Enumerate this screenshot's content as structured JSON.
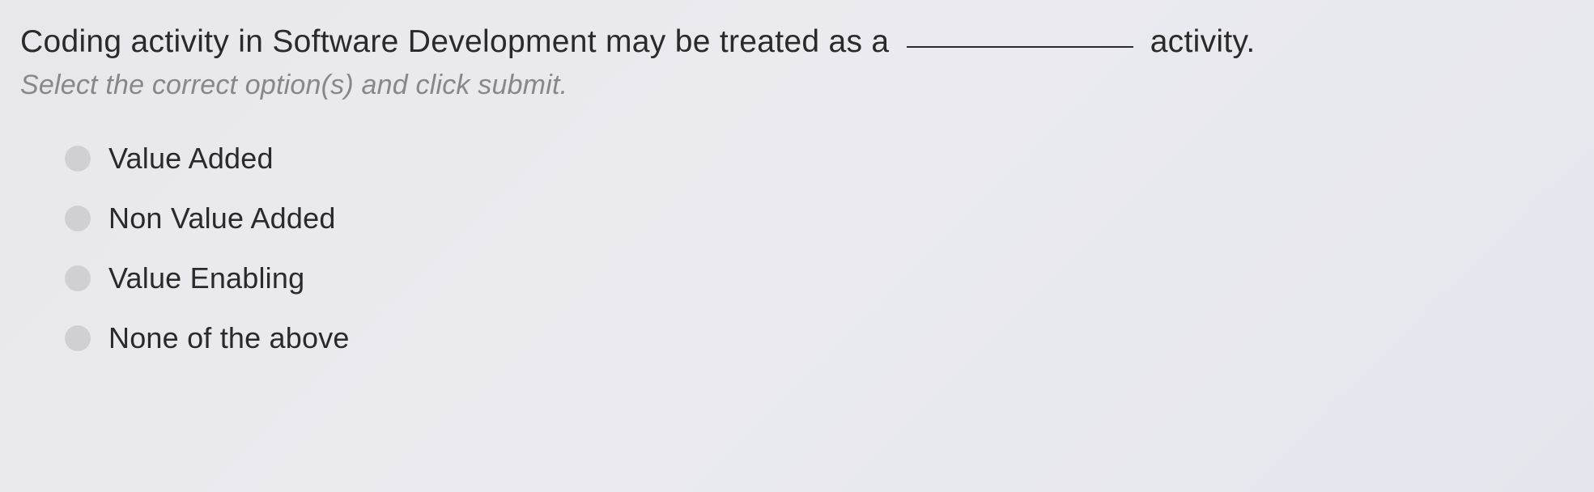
{
  "question": {
    "text_before_blank": "Coding activity in Software Development may be treated as a",
    "text_after_blank": "activity."
  },
  "instruction": "Select the correct option(s) and click submit.",
  "options": [
    {
      "label": "Value Added"
    },
    {
      "label": "Non Value Added"
    },
    {
      "label": "Value Enabling"
    },
    {
      "label": "None of the above"
    }
  ]
}
